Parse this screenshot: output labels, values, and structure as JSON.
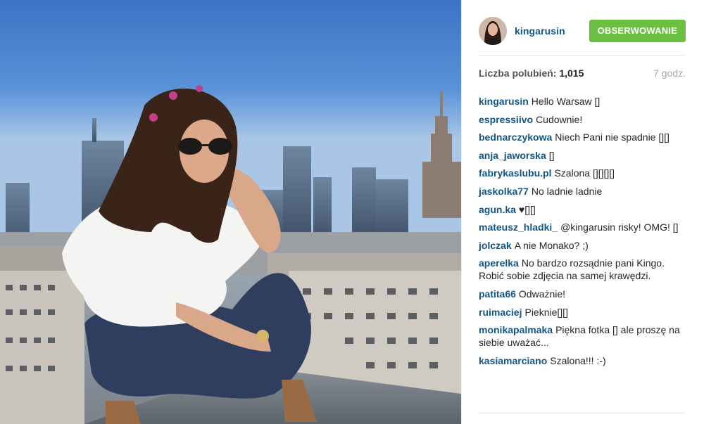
{
  "post": {
    "author": "kingarusin",
    "follow_label": "OBSERWOWANIE",
    "likes_label": "Liczba polubień:",
    "likes_count": "1,015",
    "time_ago": "7 godz."
  },
  "comments": [
    {
      "user": "kingarusin",
      "text": "Hello Warsaw []"
    },
    {
      "user": "espressiivo",
      "text": "Cudownie!"
    },
    {
      "user": "bednarczykowa",
      "text": "Niech Pani nie spadnie [][]"
    },
    {
      "user": "anja_jaworska",
      "text": "[]"
    },
    {
      "user": "fabrykaslubu.pl",
      "text": "Szalona [][][][]"
    },
    {
      "user": "jaskolka77",
      "text": "No ladnie ladnie"
    },
    {
      "user": "agun.ka",
      "text": "♥[][]"
    },
    {
      "user": "mateusz_hladki_",
      "text": "@kingarusin risky! OMG! []"
    },
    {
      "user": "jolczak",
      "text": "A nie Monako? ;)"
    },
    {
      "user": "aperelka",
      "text": "No bardzo rozsądnie pani Kingo. Robić sobie zdjęcia na samej krawędzi."
    },
    {
      "user": "patita66",
      "text": "Odważnie!"
    },
    {
      "user": "ruimaciej",
      "text": "Pieknie[][]"
    },
    {
      "user": "monikapalmaka",
      "text": "Piękna fotka [] ale proszę na siebie uważać..."
    },
    {
      "user": "kasiamarciano",
      "text": "Szalona!!! :-)"
    }
  ],
  "colors": {
    "username": "#125688",
    "follow_button": "#6bc044",
    "muted": "#a5a7aa"
  }
}
